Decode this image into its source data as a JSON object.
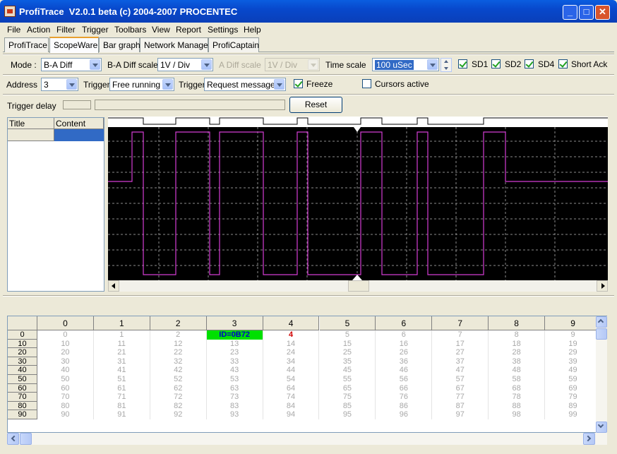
{
  "window": {
    "title": "ProfiTrace  V2.0.1 beta (c) 2004-2007 PROCENTEC",
    "minimize": "_",
    "maximize": "□",
    "close": "✕"
  },
  "menu": [
    "File",
    "Action",
    "Filter",
    "Trigger",
    "Toolbars",
    "View",
    "Report",
    "Settings",
    "Help"
  ],
  "tabs": [
    "ProfiTrace",
    "ScopeWare",
    "Bar graph",
    "Network Manager",
    "ProfiCaptain"
  ],
  "active_tab": "ScopeWare",
  "toolbar1": {
    "mode_label": "Mode :",
    "mode_value": "B-A Diff",
    "ba_scale_label": "B-A Diff scale",
    "ba_scale_value": "1V / Div",
    "a_scale_label": "A Diff scale",
    "a_scale_value": "1V / Div",
    "time_scale_label": "Time scale",
    "time_scale_value": "100 uSec",
    "sd1_label": "SD1",
    "sd1": true,
    "sd2_label": "SD2",
    "sd2": true,
    "sd4_label": "SD4",
    "sd4": true,
    "short_ack_label": "Short Ack",
    "short_ack": true
  },
  "toolbar2": {
    "address_label": "Address",
    "address_value": "3",
    "trigger_label": "Trigger",
    "trigger_value": "Free running",
    "trigger2_label": "Trigger",
    "trigger2_value": "Request message",
    "freeze_label": "Freeze",
    "freeze": true,
    "cursors_label": "Cursors active",
    "cursors": false
  },
  "toolbar3": {
    "trigger_delay_label": "Trigger delay",
    "reset_label": "Reset"
  },
  "side_table": {
    "columns": [
      "Title",
      "Content"
    ]
  },
  "scope": {
    "trace_color": "#d43cd4",
    "background": "#000000",
    "grid_color": "#8c8c8c"
  },
  "grid": {
    "columns": [
      "0",
      "1",
      "2",
      "3",
      "4",
      "5",
      "6",
      "7",
      "8",
      "9"
    ],
    "rows": [
      "0",
      "10",
      "20",
      "30",
      "40",
      "50",
      "60",
      "70",
      "80",
      "90"
    ],
    "special": {
      "id_label": "ID=0B72",
      "id_color": "#00e000",
      "byte4": "4",
      "byte4_color": "#d00000"
    }
  }
}
